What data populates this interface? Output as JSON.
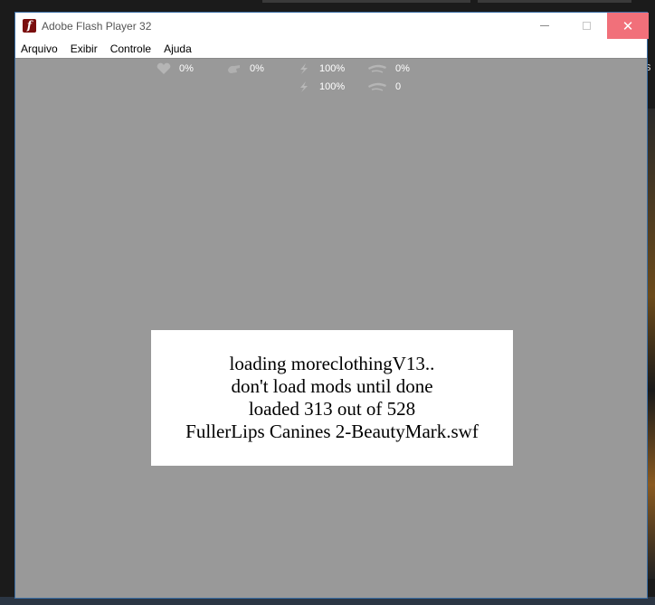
{
  "window": {
    "title": "Adobe Flash Player 32",
    "close_symbol": "✕"
  },
  "menu": [
    "Arquivo",
    "Exibir",
    "Controle",
    "Ajuda"
  ],
  "hud": {
    "heart": "0%",
    "hand": "0%",
    "bolt_top": "100%",
    "bolt_bottom": "100%",
    "brow_top": "0%",
    "brow_bottom": "0"
  },
  "loading": {
    "lines": [
      "loading moreclothingV13..",
      "don't load mods until done",
      "loaded 313 out of 528",
      "FullerLips Canines 2-BeautyMark.swf"
    ]
  },
  "background": {
    "right_letter": "s"
  },
  "colors": {
    "stage": "#999999",
    "close_hover": "#f1707a",
    "icon_red": "#7a0e0e"
  },
  "icons": [
    "flash-player-icon",
    "heart-icon",
    "hand-icon",
    "bolt-icon",
    "eyebrow-icon"
  ]
}
